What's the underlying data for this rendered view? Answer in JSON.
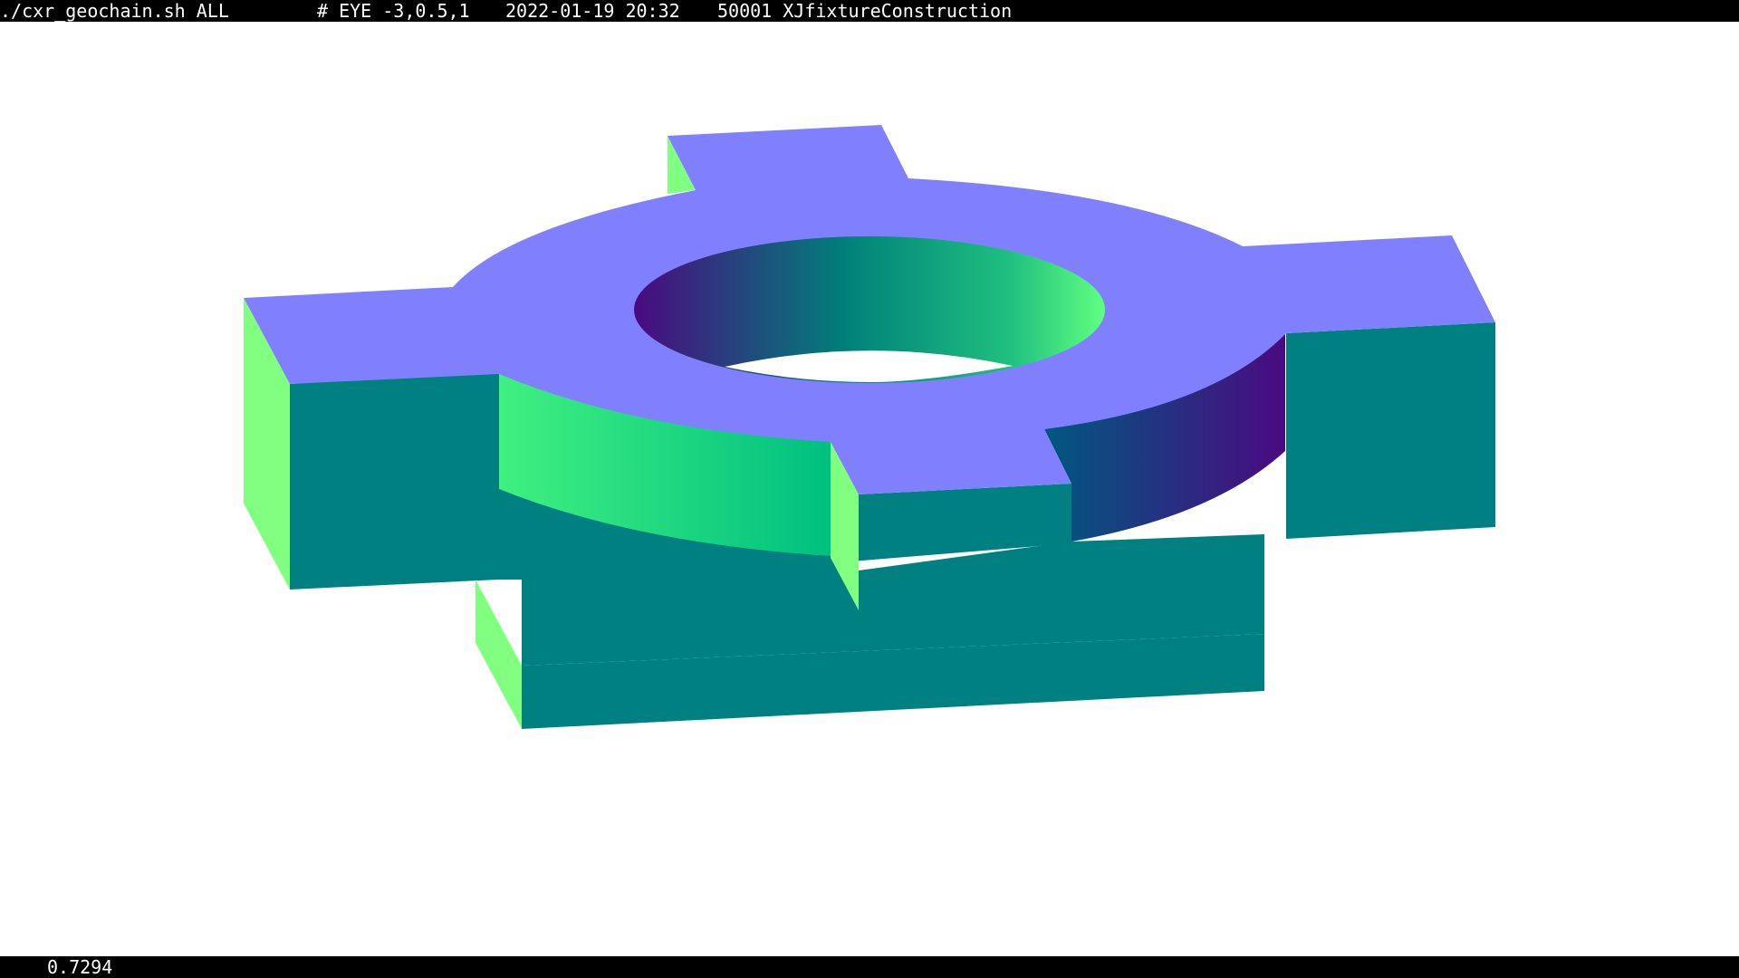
{
  "header": {
    "command": "./cxr_geochain.sh ALL",
    "eye": "# EYE -3,0.5,1",
    "timestamp": "2022-01-19 20:32",
    "geometry": "50001 XJfixtureConstruction"
  },
  "footer": {
    "value": "0.7294"
  },
  "colors": {
    "top_face": "#8080ff",
    "front_face": "#008080",
    "side_face": "#80ff80",
    "inner_dark": "#4a0a80",
    "inner_light": "#5aff80",
    "bar_bg": "#000000"
  }
}
